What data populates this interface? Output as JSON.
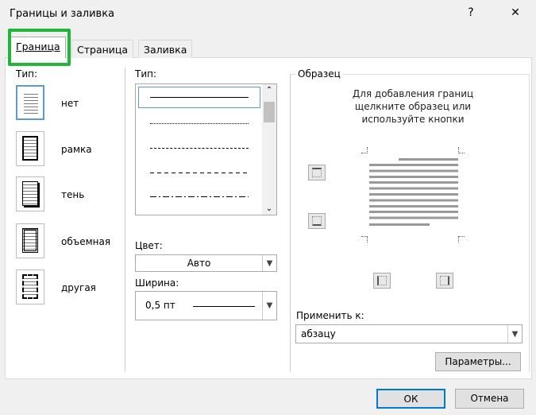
{
  "window": {
    "title": "Границы и заливка",
    "help": "?",
    "close": "✕"
  },
  "tabs": [
    {
      "label": "Граница",
      "active": true
    },
    {
      "label": "Страница"
    },
    {
      "label": "Заливка"
    }
  ],
  "highlight_color": "#22b53c",
  "setting": {
    "label": "Тип:",
    "items": [
      {
        "label": "нет",
        "selected": true
      },
      {
        "label": "рамка"
      },
      {
        "label": "тень"
      },
      {
        "label": "объемная"
      },
      {
        "label": "другая"
      }
    ]
  },
  "style": {
    "label": "Тип:",
    "lines": [
      "solid",
      "dotted",
      "dashed",
      "long-dashed",
      "dash-dot"
    ],
    "selected": 0
  },
  "color": {
    "label": "Цвет:",
    "value": "Авто"
  },
  "width": {
    "label": "Ширина:",
    "value": "0,5 пт"
  },
  "preview": {
    "label": "Образец",
    "hint": [
      "Для добавления границ",
      "щелкните образец или",
      "используйте кнопки"
    ]
  },
  "apply": {
    "label": "Применить к:",
    "value": "абзацу"
  },
  "buttons": {
    "options": "Параметры...",
    "ok": "ОК",
    "cancel": "Отмена"
  }
}
